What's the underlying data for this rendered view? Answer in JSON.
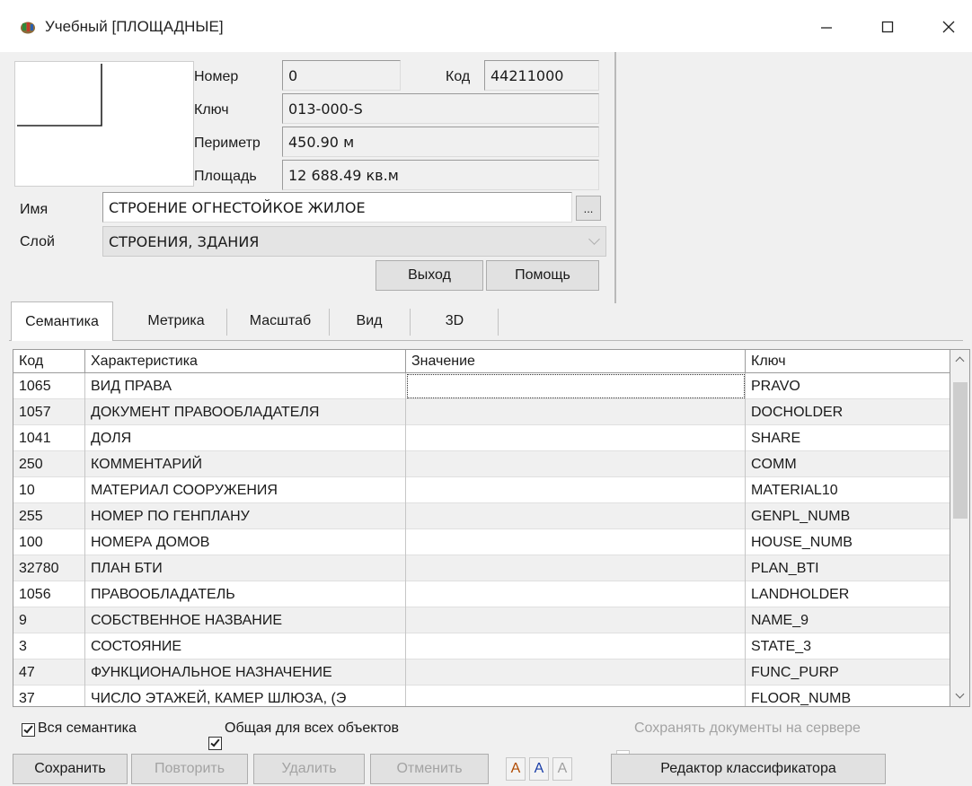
{
  "window": {
    "title": "Учебный [ПЛОЩАДНЫЕ]"
  },
  "object": {
    "number_label": "Номер",
    "number_value": "0",
    "code_label": "Код",
    "code_value": "44211000",
    "key_label": "Ключ",
    "key_value": "013-000-S",
    "perimeter_label": "Периметр",
    "perimeter_value": "450.90 м",
    "area_label": "Площадь",
    "area_value": "12 688.49 кв.м",
    "name_label": "Имя",
    "name_value": "СТРОЕНИЕ ОГНЕСТОЙКОЕ ЖИЛОЕ",
    "name_button": "...",
    "layer_label": "Слой",
    "layer_value": "СТРОЕНИЯ, ЗДАНИЯ"
  },
  "actions": {
    "exit_label": "Выход",
    "help_label": "Помощь"
  },
  "tabs": [
    {
      "label": "Семантика",
      "active": true
    },
    {
      "label": "Метрика",
      "active": false
    },
    {
      "label": "Масштаб",
      "active": false
    },
    {
      "label": "Вид",
      "active": false
    },
    {
      "label": "3D",
      "active": false
    }
  ],
  "table": {
    "columns": [
      "Код",
      "Характеристика",
      "Значение",
      "Ключ"
    ],
    "rows": [
      {
        "code": "1065",
        "name": "ВИД ПРАВА",
        "value": "",
        "key": "PRAVO"
      },
      {
        "code": "1057",
        "name": "ДОКУМЕНТ ПРАВООБЛАДАТЕЛЯ",
        "value": "",
        "key": "DOCHOLDER"
      },
      {
        "code": "1041",
        "name": "ДОЛЯ",
        "value": "",
        "key": "SHARE"
      },
      {
        "code": "250",
        "name": "КОММЕНТАРИЙ",
        "value": "",
        "key": "COMM"
      },
      {
        "code": "10",
        "name": "МАТЕРИАЛ СООРУЖЕНИЯ",
        "value": "",
        "key": "MATERIAL10"
      },
      {
        "code": "255",
        "name": "НОМЕР ПО ГЕНПЛАНУ",
        "value": "",
        "key": "GENPL_NUMB"
      },
      {
        "code": "100",
        "name": "НОМЕРА ДОМОВ",
        "value": "",
        "key": "HOUSE_NUMB"
      },
      {
        "code": "32780",
        "name": "ПЛАН БТИ",
        "value": "",
        "key": "PLAN_BTI"
      },
      {
        "code": "1056",
        "name": "ПРАВООБЛАДАТЕЛЬ",
        "value": "",
        "key": "LANDHOLDER"
      },
      {
        "code": "9",
        "name": "СОБСТВЕННОЕ НАЗВАНИЕ",
        "value": "",
        "key": "NAME_9"
      },
      {
        "code": "3",
        "name": "СОСТОЯНИЕ",
        "value": "",
        "key": "STATE_3"
      },
      {
        "code": "47",
        "name": "ФУНКЦИОНАЛЬНОЕ НАЗНАЧЕНИЕ",
        "value": "",
        "key": "FUNC_PURP"
      },
      {
        "code": "37",
        "name": "ЧИСЛО ЭТАЖЕЙ, КАМЕР ШЛЮЗА, (Э",
        "value": "",
        "key": "FLOOR_NUMB"
      }
    ]
  },
  "options": {
    "all_semantics_label": "Вся семантика",
    "all_semantics_checked": true,
    "common_label": "Общая для всех объектов",
    "common_checked": true,
    "save_on_server_label": "Сохранять документы на сервере",
    "save_on_server_checked": false
  },
  "bottom": {
    "save_label": "Сохранить",
    "repeat_label": "Повторить",
    "delete_label": "Удалить",
    "cancel_label": "Отменить",
    "font_buttons": [
      "A",
      "A",
      "A"
    ],
    "classifier_editor_label": "Редактор классификатора"
  }
}
